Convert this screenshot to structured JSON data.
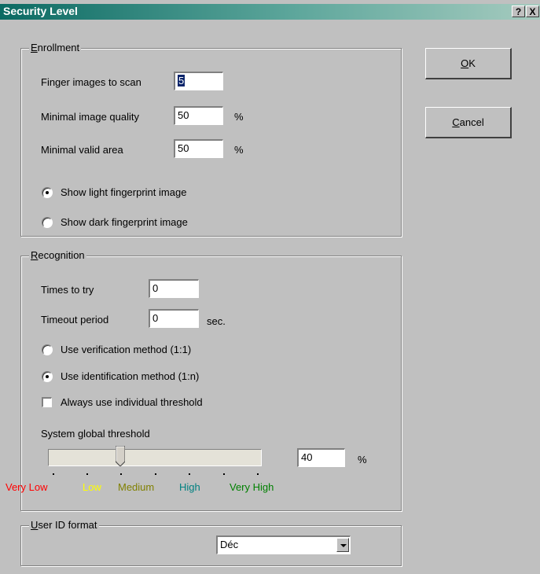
{
  "window": {
    "title": "Security Level",
    "help_label": "?",
    "close_label": "X"
  },
  "buttons": {
    "ok": {
      "access_key": "O",
      "rest": "K"
    },
    "cancel": {
      "access_key": "C",
      "rest": "ancel"
    }
  },
  "enrollment": {
    "legend_key": "E",
    "legend_rest": "nrollment",
    "finger_images_label": "Finger images to scan",
    "finger_images_value": "5",
    "min_quality_label": "Minimal image quality",
    "min_quality_value": "50",
    "min_quality_unit": "%",
    "min_area_label": "Minimal valid area",
    "min_area_value": "50",
    "min_area_unit": "%",
    "radio_light_label": "Show light fingerprint image",
    "radio_dark_label": "Show dark fingerprint image",
    "selected_image_option": "light"
  },
  "recognition": {
    "legend_key": "R",
    "legend_rest": "ecognition",
    "times_label": "Times to try",
    "times_value": "0",
    "timeout_label": "Timeout period",
    "timeout_value": "0",
    "timeout_unit": "sec.",
    "verification_label": "Use verification method (1:1)",
    "identification_label": "Use identification method (1:n)",
    "selected_method": "identification",
    "individual_threshold_label": "Always use individual threshold",
    "individual_threshold_checked": false,
    "global_threshold_label": "System global threshold",
    "threshold_value": "40",
    "threshold_unit": "%",
    "threshold_slider_fraction": 0.33,
    "levels": [
      {
        "label": "Very Low",
        "color": "#ff0000"
      },
      {
        "label": "Low",
        "color": "#ffff00"
      },
      {
        "label": "Medium",
        "color": "#808000"
      },
      {
        "label": "High",
        "color": "#008080"
      },
      {
        "label": "Very High",
        "color": "#008000"
      }
    ]
  },
  "user_id": {
    "legend_key": "U",
    "legend_rest": "ser ID format",
    "format_value": "Déc"
  }
}
